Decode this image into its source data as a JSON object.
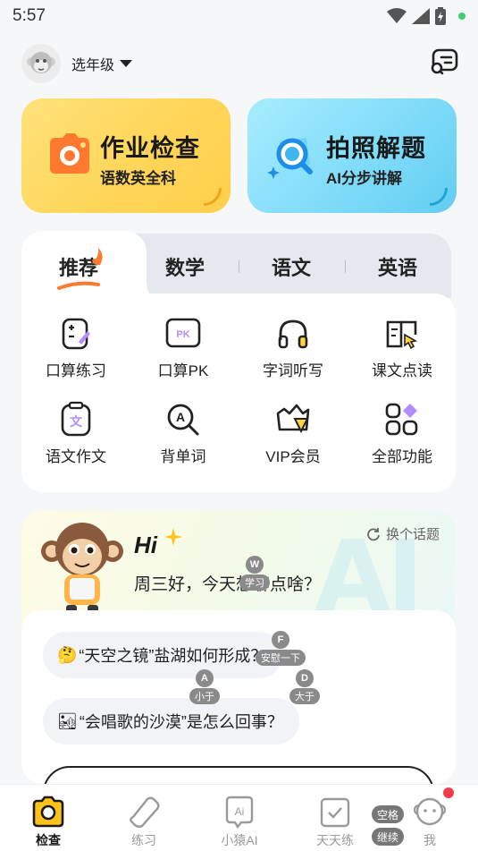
{
  "status_bar": {
    "time": "5:57"
  },
  "header": {
    "grade_label": "选年级"
  },
  "cards": [
    {
      "title": "作业检查",
      "subtitle": "语数英全科"
    },
    {
      "title": "拍照解题",
      "subtitle": "AI分步讲解"
    }
  ],
  "subject_tabs": [
    "推荐",
    "数学",
    "语文",
    "英语"
  ],
  "features": [
    {
      "label": "口算练习",
      "icon": "calc-practice-icon"
    },
    {
      "label": "口算PK",
      "icon": "pk-icon"
    },
    {
      "label": "字词听写",
      "icon": "headphones-icon"
    },
    {
      "label": "课文点读",
      "icon": "book-point-icon"
    },
    {
      "label": "语文作文",
      "icon": "essay-icon"
    },
    {
      "label": "背单词",
      "icon": "word-search-icon"
    },
    {
      "label": "VIP会员",
      "icon": "vip-icon"
    },
    {
      "label": "全部功能",
      "icon": "grid-icon"
    }
  ],
  "ai_card": {
    "hi": "Hi",
    "greeting": "周三好，今天想聊点啥？",
    "refresh_label": "换个话题",
    "suggestions": [
      {
        "emoji": "🤔",
        "text": "“天空之镜”盐湖如何形成？"
      },
      {
        "emoji": "🏜",
        "text": "“会唱歌的沙漠”是怎么回事？"
      }
    ]
  },
  "keyboard_hints": [
    {
      "key": "W",
      "label": "学习"
    },
    {
      "key": "F",
      "label": "安慰一下"
    },
    {
      "key": "D",
      "label": "大于"
    },
    {
      "key": "A",
      "label": "小于"
    }
  ],
  "bottom_nav": [
    {
      "label": "检查"
    },
    {
      "label": "练习"
    },
    {
      "label": "小猿AI"
    },
    {
      "label": "天天练"
    },
    {
      "label": "我"
    }
  ],
  "nav_pills": {
    "space": "空格",
    "continue": "继续"
  },
  "colors": {
    "yellow_card": "#ffd65a",
    "blue_card": "#80dcf9",
    "accent_orange": "#ff7a2e",
    "notify_red": "#f23c4a"
  }
}
